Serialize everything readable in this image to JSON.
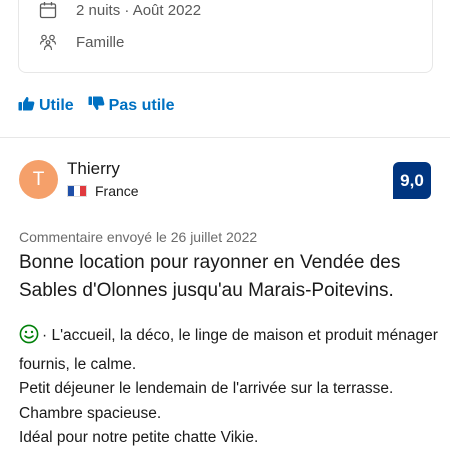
{
  "stay": {
    "nights_label": "2 nuits · Août 2022",
    "traveler_type": "Famille",
    "calendar_icon": "calendar-icon",
    "group_icon": "group-icon"
  },
  "votes": {
    "helpful_label": "Utile",
    "unhelpful_label": "Pas utile",
    "helpful_icon": "thumbs-up-icon",
    "unhelpful_icon": "thumbs-down-icon"
  },
  "review": {
    "avatar_initial": "T",
    "reviewer_name": "Thierry",
    "country": "France",
    "flag_icon": "france-flag-icon",
    "score": "9,0",
    "date_label": "Commentaire envoyé le 26 juillet 2022",
    "title": "Bonne location pour rayonner en Vendée des Sables d'Olonnes jusqu'au Marais-Poitevins.",
    "positive_icon": "smiley-icon",
    "body_lines": [
      "· L'accueil, la déco, le linge de maison et produit ménager fournis, le calme.",
      "Petit déjeuner le lendemain de l'arrivée sur la terrasse.",
      "Chambre spacieuse.",
      "Idéal pour notre petite chatte Vikie."
    ]
  },
  "colors": {
    "link_blue": "#0071c2",
    "score_badge": "#003580",
    "avatar_bg": "#f5a06a",
    "positive_green": "#008009"
  }
}
